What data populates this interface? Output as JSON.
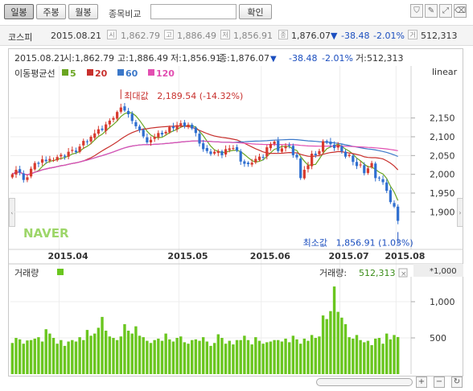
{
  "toolbar": {
    "tabs": [
      {
        "label": "일봉",
        "active": true
      },
      {
        "label": "주봉",
        "active": false
      },
      {
        "label": "월봉",
        "active": false
      }
    ],
    "compare_label": "종목비교",
    "confirm_label": "확인"
  },
  "quote": {
    "name": "코스피",
    "date": "2015.08.21",
    "open": "1,862.79",
    "high": "1,886.49",
    "low": "1,856.91",
    "close": "1,876.07",
    "change": "-38.48",
    "change_pct": "-2.01%",
    "volume": "512,313"
  },
  "info": {
    "date": "2015.08.21",
    "open_label": "시:",
    "open": "1,862.79",
    "high_label": "고:",
    "high": "1,886.49",
    "low_label": "저:",
    "low": "1,856.91",
    "close_label": "종:",
    "close": "1,876.07",
    "change": "-38.48",
    "change_pct": "-2.01%",
    "vol_label": "거:",
    "volume": "512,313",
    "scale": "linear"
  },
  "legend": {
    "title": "이동평균선",
    "items": [
      {
        "label": "5",
        "color": "#6aa521"
      },
      {
        "label": "20",
        "color": "#c8302d"
      },
      {
        "label": "60",
        "color": "#3b78c9"
      },
      {
        "label": "120",
        "color": "#e24fb1"
      }
    ]
  },
  "annotations": {
    "max_label": "최대값",
    "max": "2,189.54 (-14.32%)",
    "min_label": "최소값",
    "min": "1,856.91 (1.03%)"
  },
  "watermark": "NAVER",
  "volume_panel": {
    "title": "거래량",
    "current_label": "거래량:",
    "current": "512,313",
    "unit": "*1,000"
  },
  "chart_data": [
    {
      "type": "candlestick",
      "ylim": [
        1800,
        2250
      ],
      "yticks": [
        1900,
        1950,
        2000,
        2050,
        2100,
        2150
      ],
      "ytick_labels": [
        "1,900",
        "1,950",
        "2,000",
        "2,050",
        "2,100",
        "2,150"
      ],
      "xtick_labels": [
        "2015.04",
        "2015.05",
        "2015.06",
        "2015.07",
        "2015.08"
      ],
      "close": [
        2000,
        2012,
        2005,
        1985,
        1992,
        2015,
        2030,
        2028,
        2040,
        2035,
        2041,
        2038,
        2046,
        2052,
        2047,
        2060,
        2065,
        2059,
        2074,
        2089,
        2086,
        2100,
        2109,
        2120,
        2118,
        2133,
        2143,
        2150,
        2166,
        2178,
        2170,
        2160,
        2142,
        2128,
        2117,
        2101,
        2085,
        2092,
        2100,
        2110,
        2106,
        2113,
        2126,
        2123,
        2131,
        2136,
        2128,
        2132,
        2122,
        2110,
        2082,
        2067,
        2062,
        2054,
        2060,
        2062,
        2051,
        2067,
        2069,
        2070,
        2063,
        2034,
        2028,
        2027,
        2031,
        2041,
        2047,
        2046,
        2072,
        2081,
        2087,
        2062,
        2069,
        2075,
        2077,
        2051,
        2045,
        1990,
        2012,
        2024,
        2055,
        2051,
        2062,
        2088,
        2084,
        2080,
        2070,
        2078,
        2061,
        2047,
        2052,
        2033,
        2022,
        2026,
        2003,
        2016,
        2030,
        1990,
        1990,
        1979,
        1956,
        1926,
        1914,
        1876
      ],
      "series": [
        {
          "name": "5",
          "ma": 5
        },
        {
          "name": "20",
          "ma": 20
        },
        {
          "name": "60",
          "ma": 60
        },
        {
          "name": "120",
          "ma": 120
        }
      ],
      "max": {
        "value": 2189.54,
        "label": "최대값 2,189.54 (-14.32%)"
      },
      "min": {
        "value": 1856.91,
        "label": "최소값 1,856.91 (1.03%)"
      }
    },
    {
      "type": "bar",
      "ylim": [
        0,
        1300
      ],
      "yticks": [
        500,
        1000
      ],
      "ytick_labels": [
        "500",
        "1,000"
      ],
      "series": [
        {
          "name": "거래량"
        }
      ],
      "values": [
        430,
        500,
        480,
        420,
        465,
        470,
        490,
        510,
        450,
        620,
        560,
        500,
        420,
        470,
        390,
        450,
        470,
        450,
        510,
        470,
        610,
        530,
        560,
        640,
        790,
        600,
        520,
        500,
        470,
        520,
        690,
        600,
        560,
        660,
        530,
        510,
        460,
        430,
        470,
        490,
        460,
        560,
        480,
        450,
        500,
        520,
        440,
        420,
        470,
        480,
        460,
        510,
        450,
        390,
        430,
        550,
        500,
        420,
        460,
        410,
        470,
        470,
        530,
        470,
        410,
        510,
        460,
        420,
        440,
        450,
        470,
        470,
        450,
        490,
        440,
        530,
        480,
        420,
        490,
        460,
        540,
        500,
        520,
        810,
        760,
        870,
        1210,
        860,
        780,
        690,
        510,
        490,
        540,
        470,
        440,
        460,
        400,
        490,
        500,
        420,
        560,
        480,
        540,
        512
      ]
    }
  ]
}
